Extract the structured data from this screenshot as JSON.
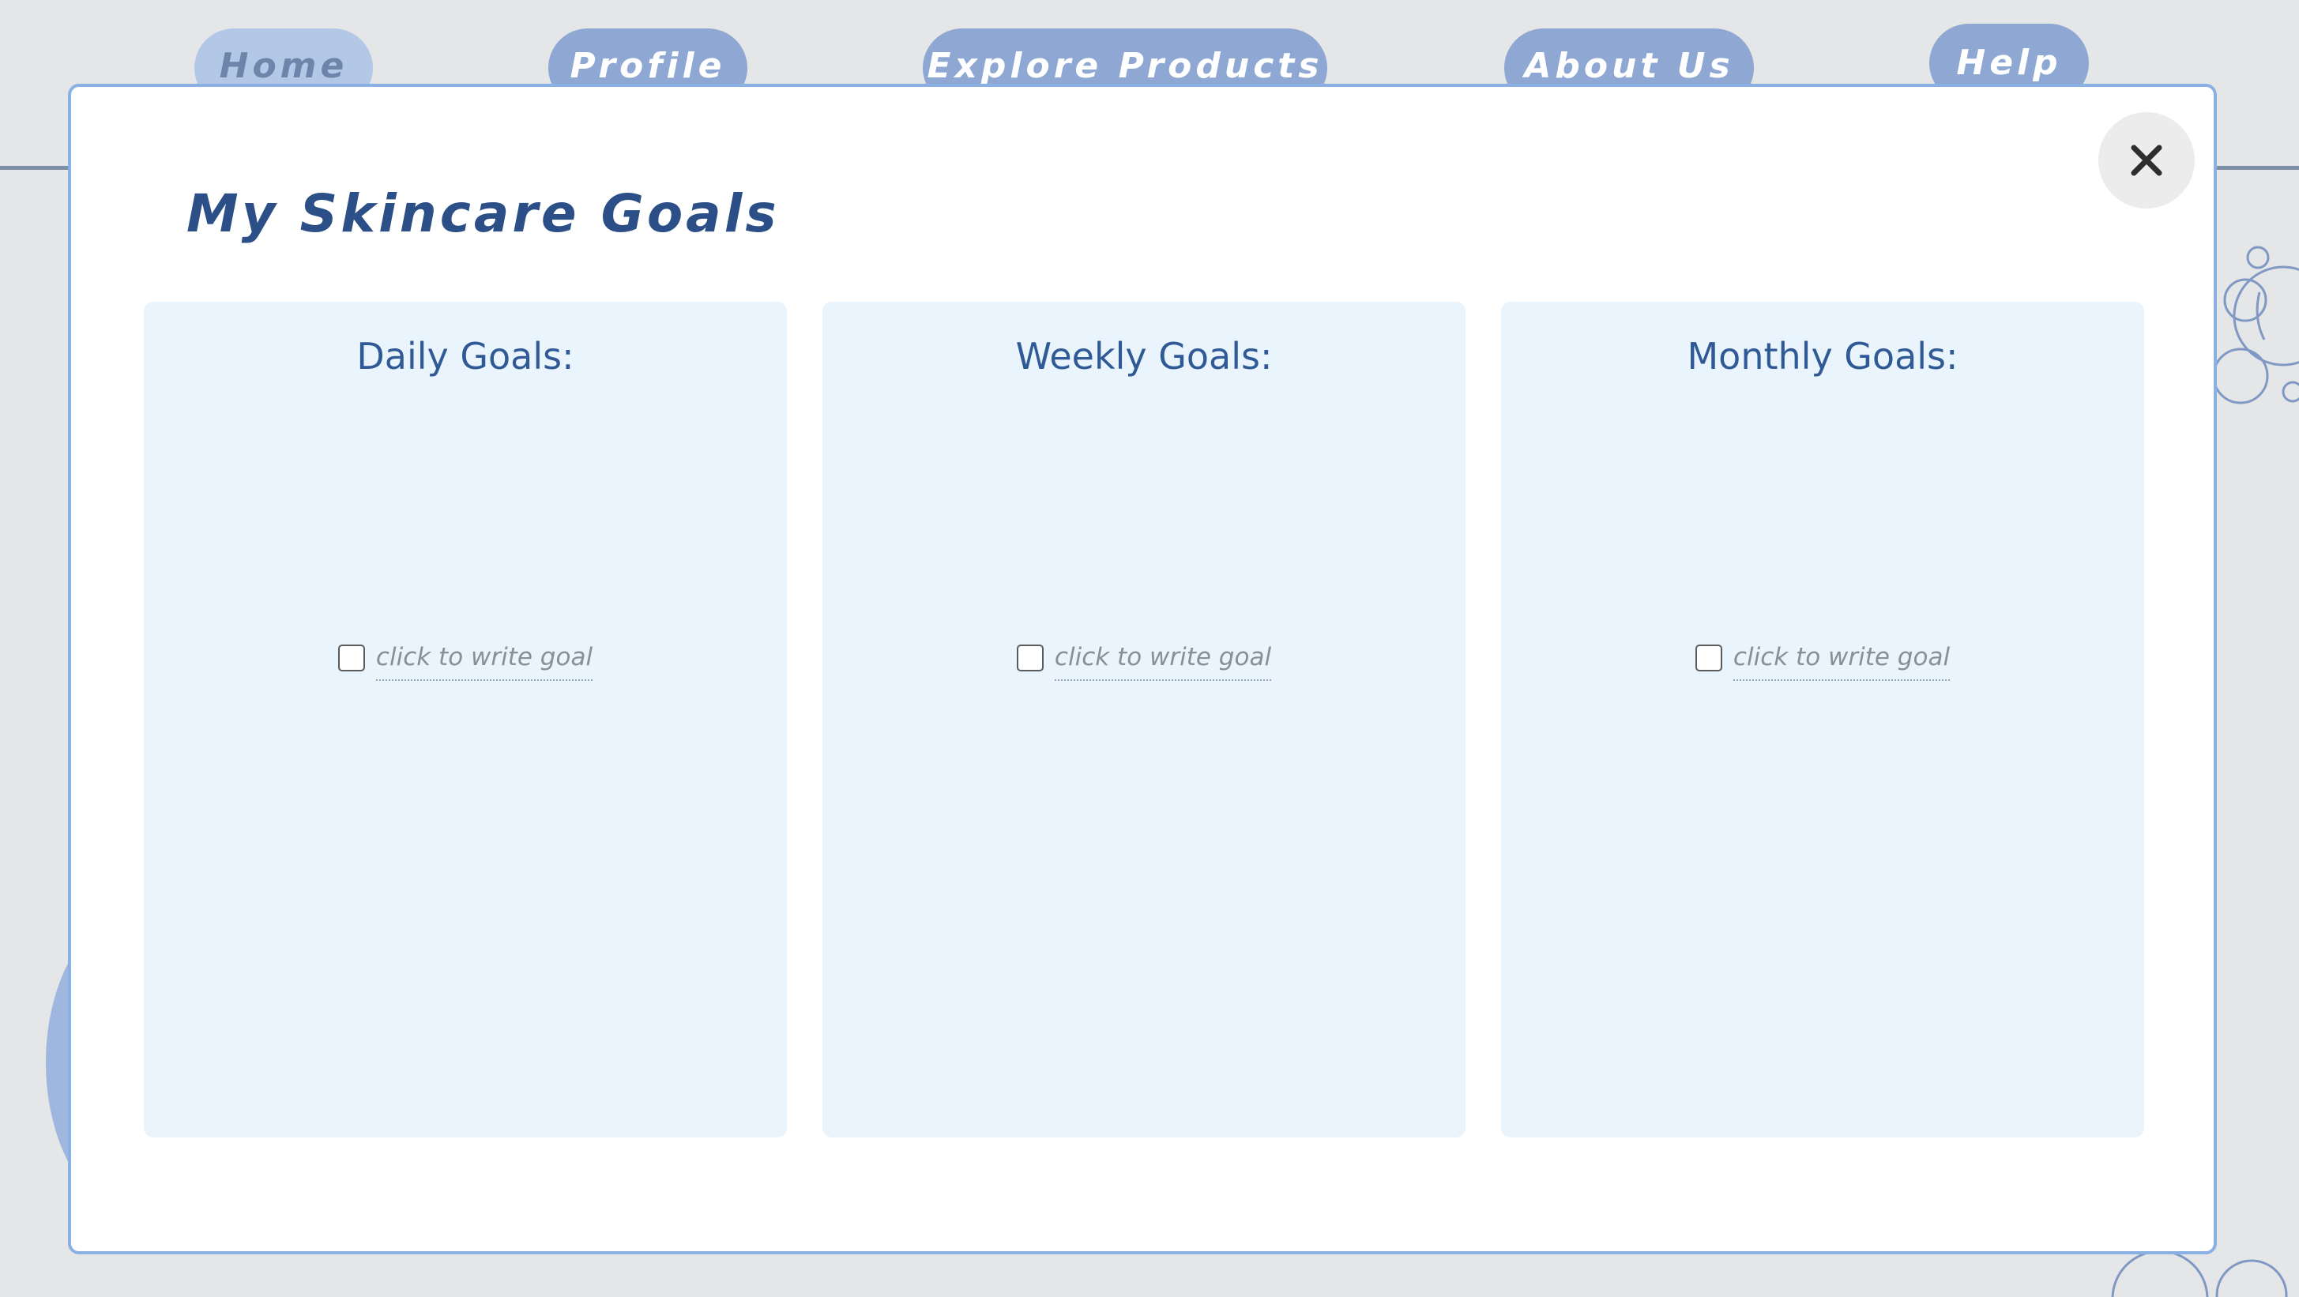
{
  "nav": {
    "items": [
      {
        "label": "Home",
        "active": true
      },
      {
        "label": "Profile"
      },
      {
        "label": "Explore Products"
      },
      {
        "label": "About Us"
      },
      {
        "label": "Help"
      }
    ]
  },
  "modal": {
    "title": "My Skincare Goals",
    "close_icon": "close-icon",
    "columns": [
      {
        "heading": "Daily Goals:",
        "goal_placeholder": "click to write goal",
        "checked": false
      },
      {
        "heading": "Weekly Goals:",
        "goal_placeholder": "click to write goal",
        "checked": false
      },
      {
        "heading": "Monthly Goals:",
        "goal_placeholder": "click to write goal",
        "checked": false
      }
    ]
  },
  "colors": {
    "accent": "#2b4f86",
    "nav_button": "#8ea8d3",
    "nav_button_active": "#b3c7e6",
    "column_bg": "#eaf4fd",
    "modal_border": "#8ab0e4"
  }
}
